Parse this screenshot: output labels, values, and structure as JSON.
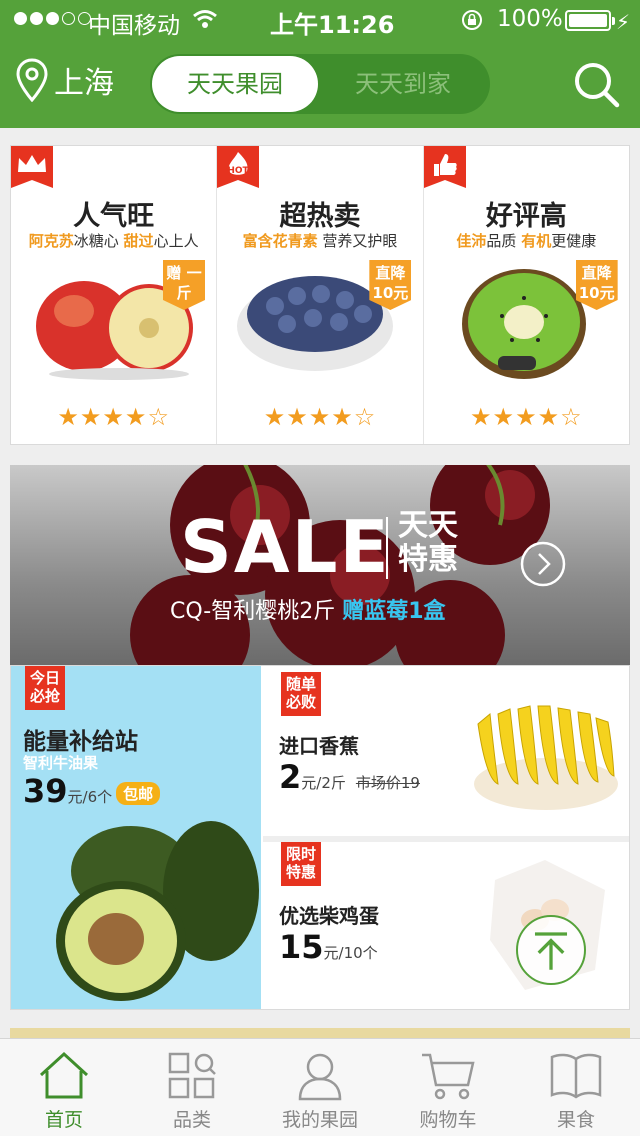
{
  "status_bar": {
    "carrier": "中国移动",
    "time": "上午11:26",
    "battery": "100%"
  },
  "header": {
    "city": "上海",
    "tabs": [
      {
        "label": "天天果园",
        "active": true
      },
      {
        "label": "天天到家",
        "active": false
      }
    ]
  },
  "features": [
    {
      "title": "人气旺",
      "sub": [
        {
          "text": "阿克苏",
          "hl": true
        },
        {
          "text": "冰糖心 ",
          "hl": false
        },
        {
          "text": "甜过",
          "hl": true
        },
        {
          "text": "心上人",
          "hl": false
        }
      ],
      "tag": "赠 一斤",
      "badge": "crown-icon",
      "stars": "★★★★☆"
    },
    {
      "title": "超热卖",
      "sub": [
        {
          "text": "富含花青素",
          "hl": true
        },
        {
          "text": " 营养又护眼",
          "hl": false
        }
      ],
      "tag": "直降 10元",
      "badge": "hot-icon",
      "stars": "★★★★☆"
    },
    {
      "title": "好评高",
      "sub": [
        {
          "text": "佳沛",
          "hl": true
        },
        {
          "text": "品质 ",
          "hl": false
        },
        {
          "text": "有机",
          "hl": true
        },
        {
          "text": "更健康",
          "hl": false
        }
      ],
      "tag": "直降 10元",
      "badge": "thumbs-up-icon",
      "stars": "★★★★☆"
    }
  ],
  "banner": {
    "sale": "SALE",
    "daily": "天天 特惠",
    "sub_text": "CQ-智利樱桃2斤 ",
    "sub_bold": "赠蓝莓1盒"
  },
  "promo_left": {
    "badge": "今日 必抢",
    "title": "能量补给站",
    "sub": "智利牛油果",
    "price": "39",
    "unit": "元/6个",
    "tag": "包邮"
  },
  "promo_right": [
    {
      "badge": "随单 必败",
      "title": "进口香蕉",
      "price": "2",
      "unit": "元/2斤",
      "market": "市场价19"
    },
    {
      "badge": "限时 特惠",
      "title": "优选柴鸡蛋",
      "price": "15",
      "unit": "元/10个"
    }
  ],
  "tabbar": [
    {
      "label": "首页",
      "icon": "home-icon",
      "active": true
    },
    {
      "label": "品类",
      "icon": "category-icon",
      "active": false
    },
    {
      "label": "我的果园",
      "icon": "user-icon",
      "active": false
    },
    {
      "label": "购物车",
      "icon": "cart-icon",
      "active": false
    },
    {
      "label": "果食",
      "icon": "book-icon",
      "active": false
    }
  ],
  "colors": {
    "brand_green": "#55a23a",
    "orange": "#f09a1f",
    "red": "#e6331f",
    "blue": "#38c6f0"
  }
}
